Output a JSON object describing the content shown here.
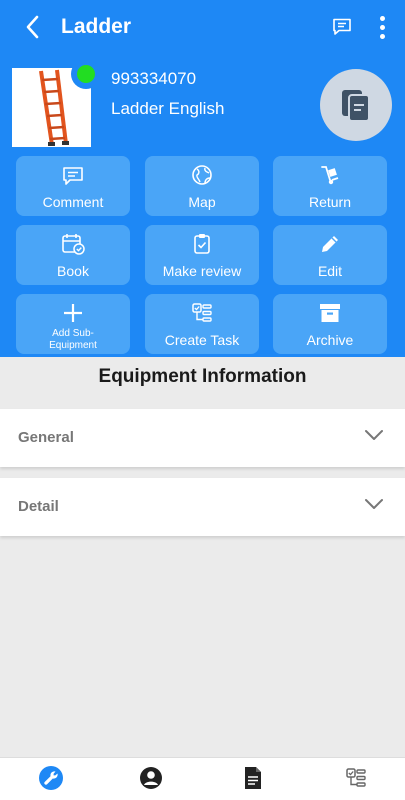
{
  "topbar": {
    "title": "Ladder",
    "icons": [
      "back-icon",
      "message-icon",
      "more-vertical-icon"
    ]
  },
  "equipment": {
    "id": "993334070",
    "name": "Ladder English",
    "status_color": "#22dd22",
    "image": "ladder-image"
  },
  "colors": {
    "header": "#1e88f5",
    "button": "#4aa5f7",
    "fab": "#cfd8e3",
    "active_nav": "#1e88f5"
  },
  "actions": [
    {
      "label": "Comment",
      "icon": "comment-icon"
    },
    {
      "label": "Map",
      "icon": "globe-icon"
    },
    {
      "label": "Return",
      "icon": "hand-truck-icon"
    },
    {
      "label": "Book",
      "icon": "calendar-icon"
    },
    {
      "label": "Make review",
      "icon": "clipboard-check-icon"
    },
    {
      "label": "Edit",
      "icon": "pencil-icon"
    },
    {
      "label": "Add Sub-Equipment",
      "icon": "plus-icon"
    },
    {
      "label": "Create Task",
      "icon": "task-icon"
    },
    {
      "label": "Archive",
      "icon": "archive-icon"
    }
  ],
  "main": {
    "section_title": "Equipment Information",
    "accordions": [
      {
        "label": "General"
      },
      {
        "label": "Detail"
      }
    ]
  },
  "bottom_nav": [
    "wrench-icon",
    "user-icon",
    "document-icon",
    "task-icon"
  ]
}
